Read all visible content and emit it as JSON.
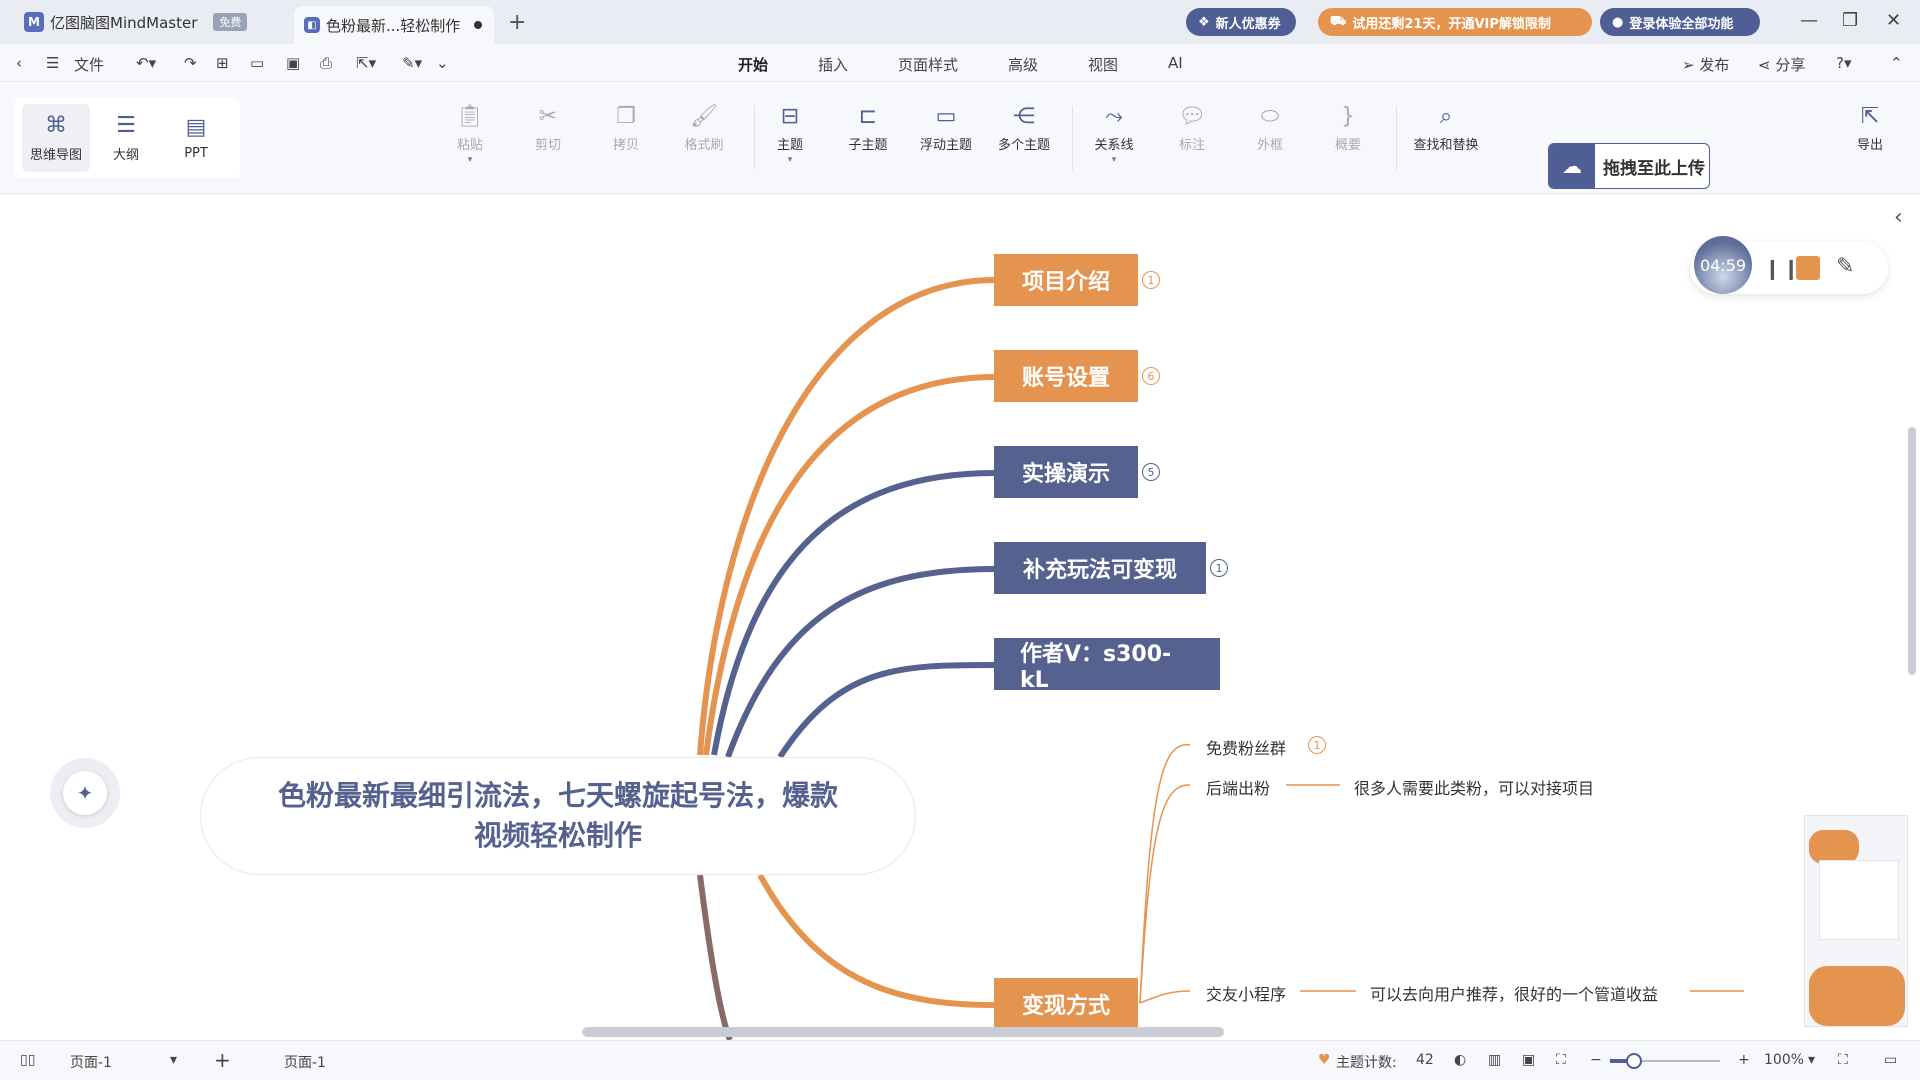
{
  "titlebar": {
    "app_tab": "亿图脑图MindMaster",
    "app_badge": "免费",
    "doc_tab": "色粉最新...轻松制作",
    "coupon": "新人优惠券",
    "trial": "试用还剩21天，开通VIP解锁限制",
    "login": "登录体验全部功能"
  },
  "menubar": {
    "file": "文件",
    "tabs": [
      "开始",
      "插入",
      "页面样式",
      "高级",
      "视图",
      "AI"
    ],
    "active_tab": "开始",
    "publish": "发布",
    "share": "分享"
  },
  "toolbar": {
    "views": [
      "思维导图",
      "大纲",
      "PPT"
    ],
    "buttons": [
      "粘贴",
      "剪切",
      "拷贝",
      "格式刷",
      "主题",
      "子主题",
      "浮动主题",
      "多个主题",
      "关系线",
      "标注",
      "外框",
      "概要",
      "查找和替换"
    ],
    "upload": "拖拽至此上传",
    "export": "导出"
  },
  "mindmap": {
    "central": [
      "色粉最新最细引流法，七天螺旋起号法，爆款",
      "视频轻松制作"
    ],
    "topics": [
      {
        "label": "项目介绍",
        "marker": "1",
        "color": "#e5944f"
      },
      {
        "label": "账号设置",
        "marker": "6",
        "color": "#e5944f"
      },
      {
        "label": "实操演示",
        "marker": "5",
        "color": "#55618f"
      },
      {
        "label": "补充玩法可变现",
        "marker": "1",
        "color": "#55618f"
      },
      {
        "label": "作者V：s300-kL",
        "marker": "",
        "color": "#55618f"
      },
      {
        "label": "变现方式",
        "marker": "",
        "color": "#e5944f"
      }
    ],
    "subtopics": {
      "free_group": "免费粉丝群",
      "free_group_marker": "1",
      "backend": "后端出粉",
      "backend_note": "很多人需要此类粉，可以对接项目",
      "mini_program": "交友小程序",
      "mini_program_note": "可以去向用户推荐，很好的一个管道收益"
    }
  },
  "timer": {
    "time": "04:59"
  },
  "statusbar": {
    "page_select": "页面-1",
    "page_tab": "页面-1",
    "topic_count_label": "主题计数:",
    "topic_count": "42",
    "zoom": "100%",
    "zoom_level": 0.22
  },
  "colors": {
    "accent": "#4f5e94",
    "orange": "#e5944f",
    "blue_topic": "#55618f"
  }
}
